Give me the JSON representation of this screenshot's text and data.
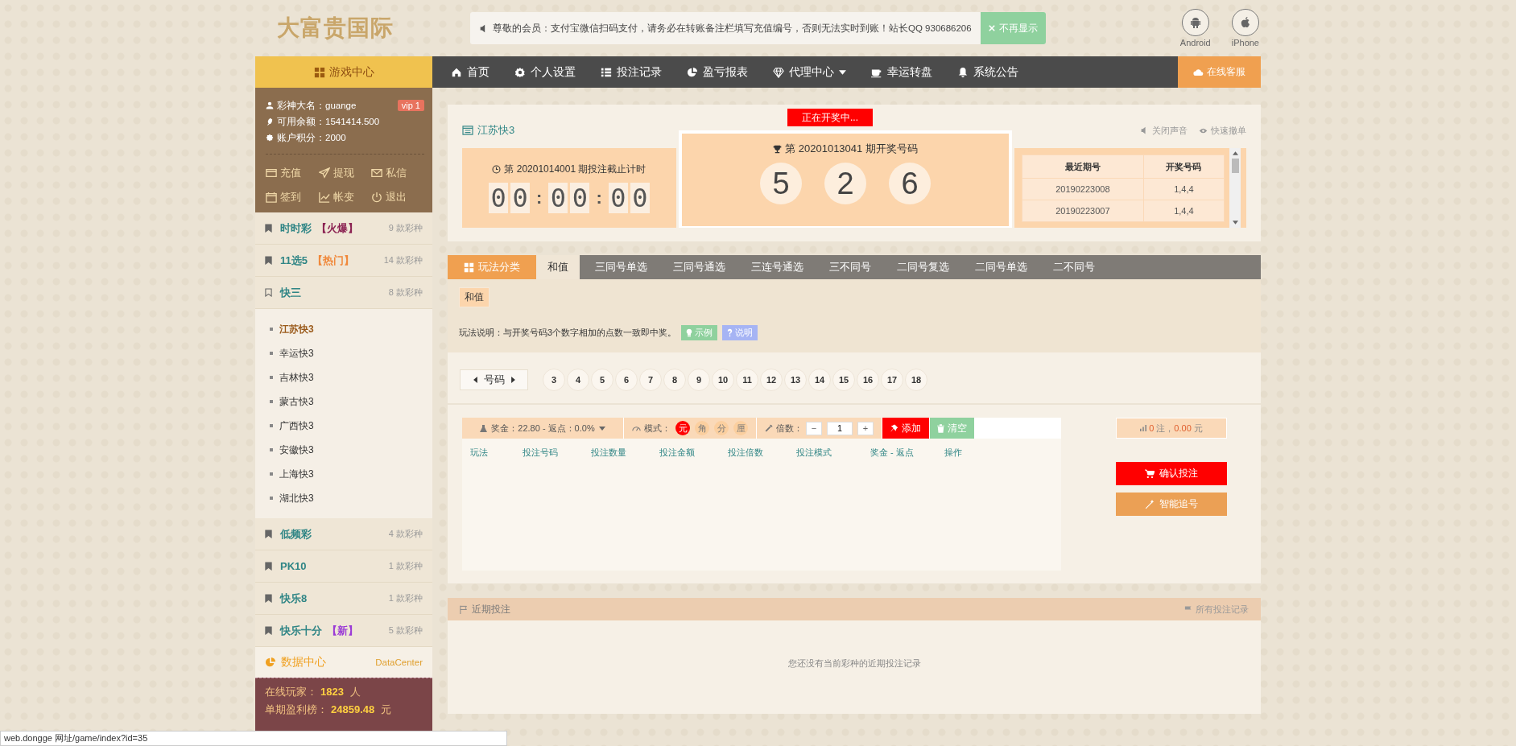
{
  "header": {
    "logo": "大富贵国际",
    "notice": "尊敬的会员：支付宝微信扫码支付，请务必在转账备注栏填写充值编号，否则无法实时到账！站长QQ 930686206",
    "notice_button": "不再显示",
    "apps": [
      {
        "kind": "android",
        "label": "Android"
      },
      {
        "kind": "apple",
        "label": "iPhone"
      }
    ]
  },
  "nav": {
    "game_center": "游戏中心",
    "items": [
      {
        "kind": "home",
        "label": "首页",
        "dropdown": false
      },
      {
        "kind": "gear",
        "label": "个人设置",
        "dropdown": false
      },
      {
        "kind": "list",
        "label": "投注记录",
        "dropdown": false
      },
      {
        "kind": "pie",
        "label": "盈亏报表",
        "dropdown": false
      },
      {
        "kind": "diamond",
        "label": "代理中心",
        "dropdown": true
      },
      {
        "kind": "cup",
        "label": "幸运转盘",
        "dropdown": false
      },
      {
        "kind": "bell",
        "label": "系统公告",
        "dropdown": false
      }
    ],
    "service": "在线客服"
  },
  "user": {
    "fields": [
      {
        "kind": "user",
        "label": "彩神大名：",
        "value": "guange"
      },
      {
        "kind": "money",
        "label": "可用余额：",
        "value": "1541414.500"
      },
      {
        "kind": "points",
        "label": "账户积分：",
        "value": "2000"
      }
    ],
    "vip": "vip 1",
    "actions": [
      {
        "kind": "card",
        "label": "充值"
      },
      {
        "kind": "send",
        "label": "提现"
      },
      {
        "kind": "mail",
        "label": "私信"
      },
      {
        "kind": "calendar",
        "label": "签到"
      },
      {
        "kind": "chart",
        "label": "帐变"
      },
      {
        "kind": "power",
        "label": "退出"
      }
    ]
  },
  "categories": [
    {
      "name": "时时彩",
      "tag": "【火爆】",
      "color": "#8b2252",
      "count": "9 款彩种",
      "expanded": false
    },
    {
      "name": "11选5",
      "tag": "【热门】",
      "color": "#f0883a",
      "count": "14 款彩种",
      "expanded": false
    },
    {
      "name": "快三",
      "count": "8 款彩种",
      "expanded": true,
      "children": [
        {
          "label": "江苏快3",
          "selected": true
        },
        {
          "label": "幸运快3",
          "selected": false
        },
        {
          "label": "吉林快3",
          "selected": false
        },
        {
          "label": "蒙古快3",
          "selected": false
        },
        {
          "label": "广西快3",
          "selected": false
        },
        {
          "label": "安徽快3",
          "selected": false
        },
        {
          "label": "上海快3",
          "selected": false
        },
        {
          "label": "湖北快3",
          "selected": false
        }
      ]
    },
    {
      "name": "低频彩",
      "count": "4 款彩种",
      "expanded": false
    },
    {
      "name": "PK10",
      "count": "1 款彩种",
      "expanded": false
    },
    {
      "name": "快乐8",
      "count": "1 款彩种",
      "expanded": false
    },
    {
      "name": "快乐十分",
      "tag": "【新】",
      "color": "#9b3bd6",
      "count": "5 款彩种",
      "expanded": false
    }
  ],
  "data_center": {
    "title": "数据中心",
    "subtitle": "DataCenter",
    "stats": [
      {
        "label": "在线玩家：",
        "value": "1823",
        "unit": "人"
      },
      {
        "label": "单期盈利榜：",
        "value": "24859.48",
        "unit": "元"
      }
    ]
  },
  "game": {
    "title": "江苏快3",
    "drawing_status": "正在开奖中...",
    "sound": "关闭声音",
    "quick_cancel": "快速撤单",
    "countdown": {
      "label": "第 20201014001 期投注截止计时",
      "groups": [
        [
          "0",
          "0"
        ],
        [
          "0",
          "0"
        ],
        [
          "0",
          "0"
        ]
      ],
      "separator": ":"
    },
    "result": {
      "label": "第 20201013041 期开奖号码",
      "balls": [
        "5",
        "2",
        "6"
      ]
    },
    "recent_table": {
      "columns": [
        "最近期号",
        "开奖号码"
      ],
      "rows": [
        [
          "20190223008",
          "1,4,4"
        ],
        [
          "20190223007",
          "1,4,4"
        ]
      ]
    }
  },
  "play_tabs": {
    "category": "玩法分类",
    "tabs": [
      {
        "label": "和值",
        "selected": true
      },
      {
        "label": "三同号单选",
        "selected": false
      },
      {
        "label": "三同号通选",
        "selected": false
      },
      {
        "label": "三连号通选",
        "selected": false
      },
      {
        "label": "三不同号",
        "selected": false
      },
      {
        "label": "二同号复选",
        "selected": false
      },
      {
        "label": "二同号单选",
        "selected": false
      },
      {
        "label": "二不同号",
        "selected": false
      }
    ],
    "subtabs": [
      {
        "label": "和值",
        "selected": true
      }
    ],
    "description": "玩法说明：与开奖号码3个数字相加的点数一致即中奖。",
    "example_button": "示例",
    "explain_button": "说明"
  },
  "number_picker": {
    "label": "号码",
    "numbers": [
      "3",
      "4",
      "5",
      "6",
      "7",
      "8",
      "9",
      "10",
      "11",
      "12",
      "13",
      "14",
      "15",
      "16",
      "17",
      "18"
    ]
  },
  "bet": {
    "prize": "奖金：22.80 - 返点：0.0%",
    "mode_label": "模式：",
    "modes": [
      {
        "label": "元",
        "selected": true
      },
      {
        "label": "角",
        "selected": false
      },
      {
        "label": "分",
        "selected": false
      },
      {
        "label": "厘",
        "selected": false
      }
    ],
    "multiple_label": "倍数：",
    "minus": "−",
    "multiple": "1",
    "plus": "+",
    "add": "添加",
    "clear": "清空",
    "columns": [
      "玩法",
      "投注号码",
      "投注数量",
      "投注金额",
      "投注倍数",
      "投注模式",
      "奖金 - 返点",
      "操作"
    ],
    "summary": {
      "count": "0",
      "count_unit": "注，",
      "amount": "0.00",
      "currency": "元"
    },
    "confirm": "确认投注",
    "chase": "智能追号"
  },
  "recent_bets": {
    "title": "近期投注",
    "all_link": "所有投注记录",
    "empty": "您还没有当前彩种的近期投注记录"
  },
  "status_url": "web.dongge 网址/game/index?id=35"
}
